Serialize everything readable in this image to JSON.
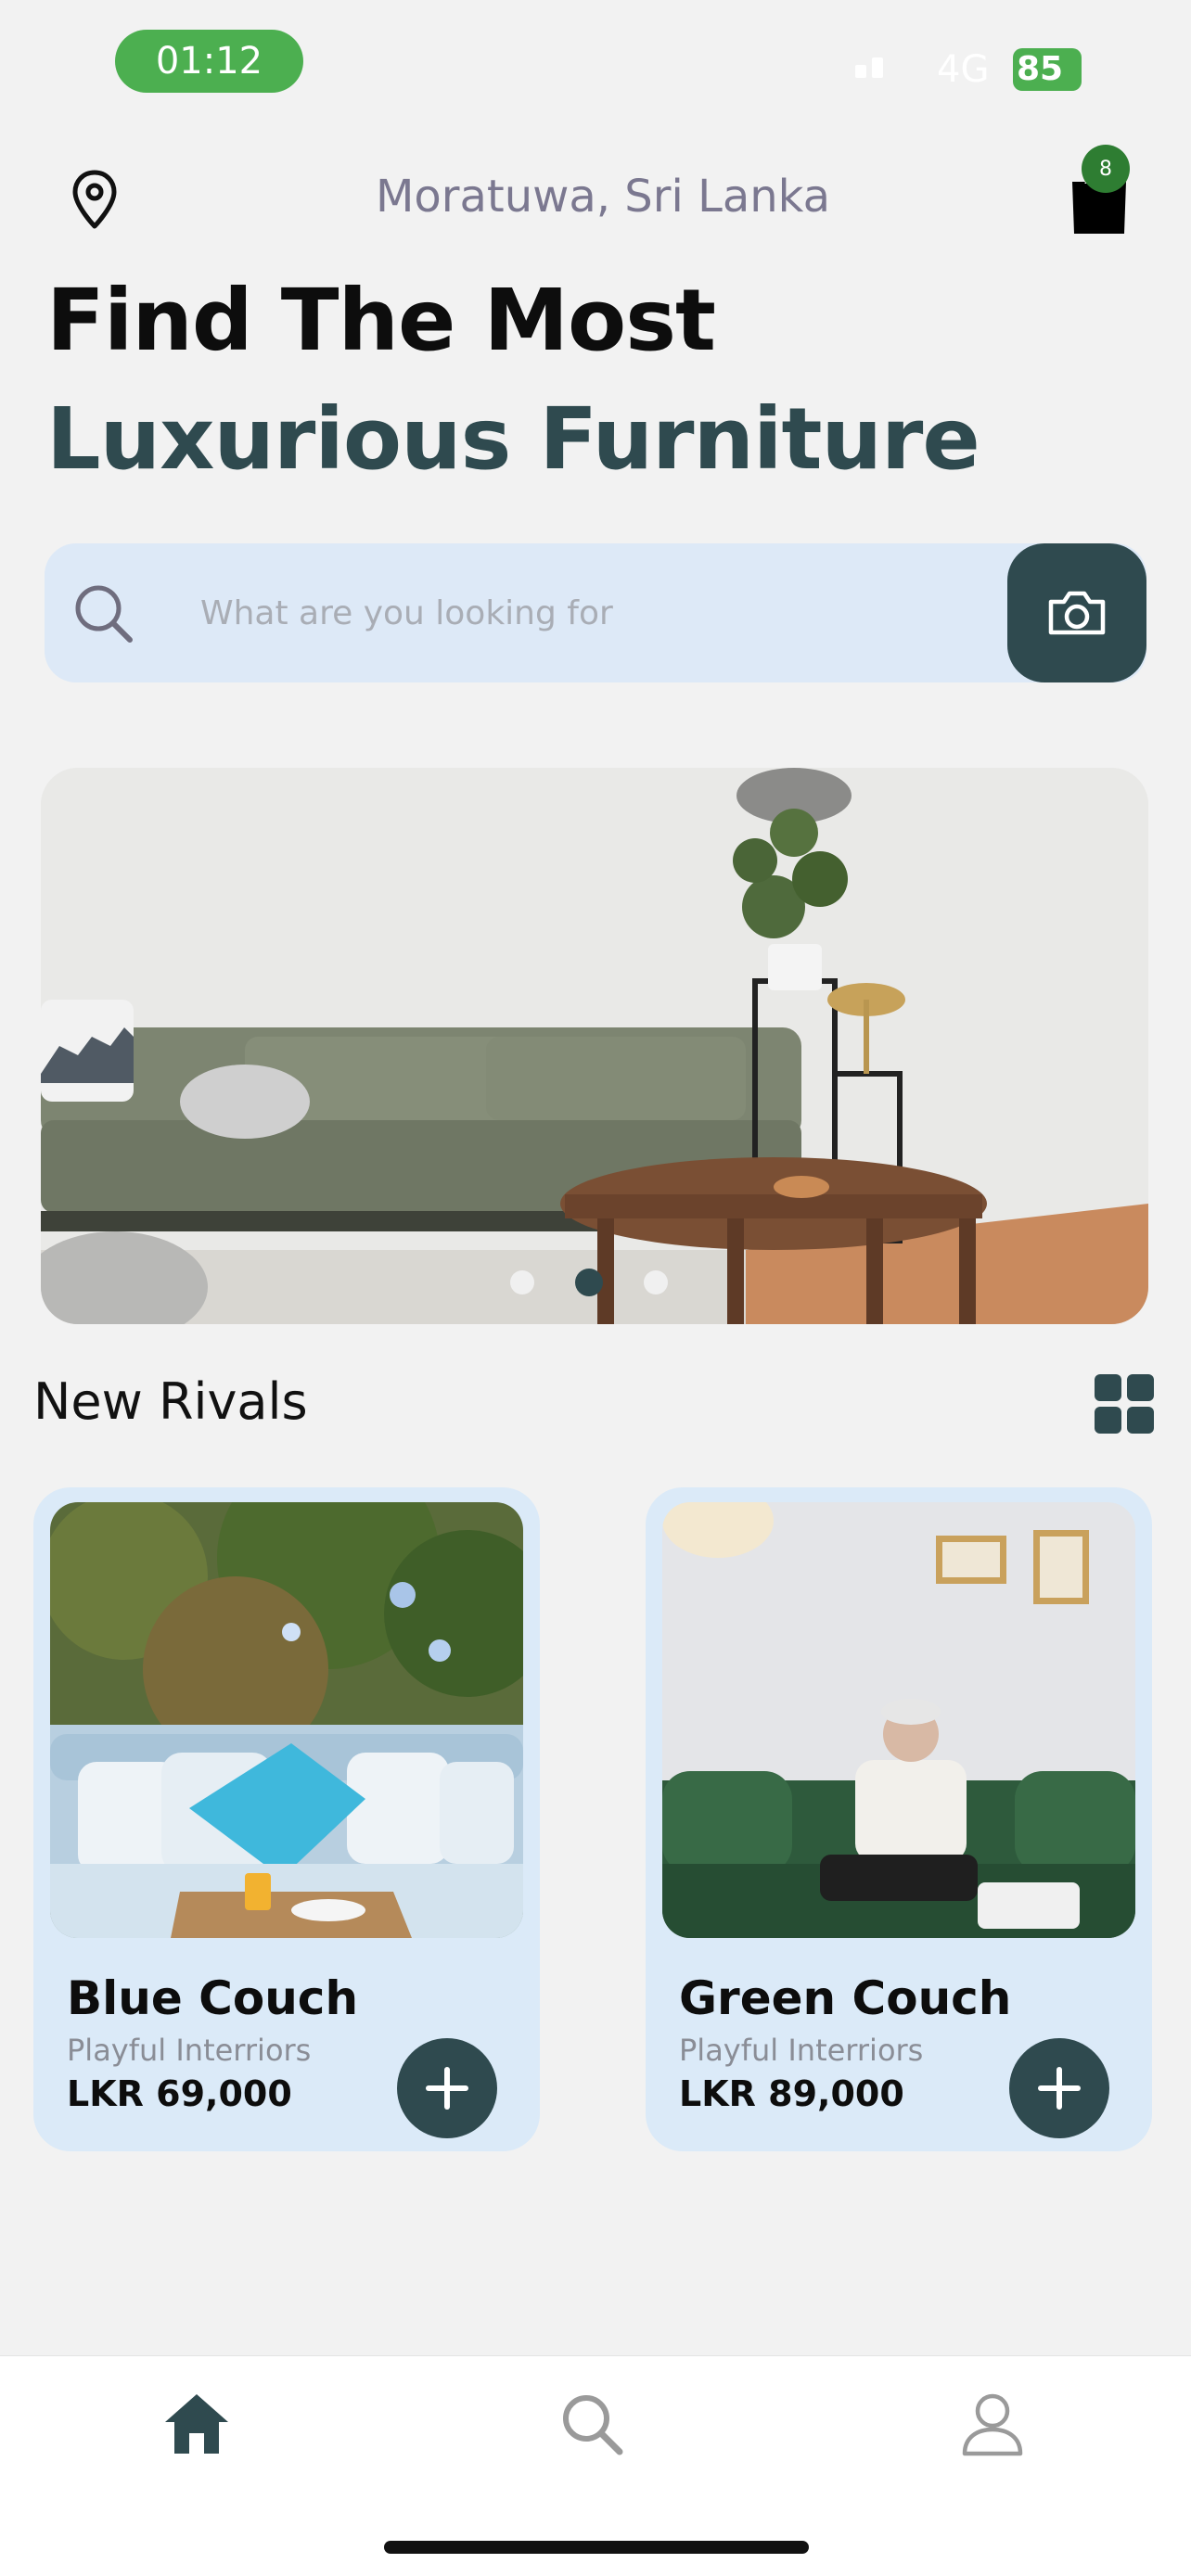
{
  "status_bar": {
    "time": "01:12",
    "network": "4G",
    "battery": "85"
  },
  "header": {
    "location": "Moratuwa, Sri Lanka",
    "cart_count": "8"
  },
  "headline": {
    "line1": "Find The Most",
    "line2": "Luxurious Furniture"
  },
  "search": {
    "placeholder": "What are you looking for"
  },
  "carousel": {
    "slide_count": 3,
    "active_index": 1
  },
  "section": {
    "title": "New Rivals"
  },
  "products": [
    {
      "name": "Blue Couch",
      "seller": "Playful Interriors",
      "price": "LKR 69,000"
    },
    {
      "name": "Green Couch",
      "seller": "Playful Interriors",
      "price": "LKR 89,000"
    }
  ],
  "bottom_nav": {
    "items": [
      {
        "icon": "home-icon",
        "active": true
      },
      {
        "icon": "search-icon",
        "active": false
      },
      {
        "icon": "profile-icon",
        "active": false
      }
    ]
  },
  "colors": {
    "accent": "#2f4a4f",
    "search_bg": "#dde9f7",
    "card_bg": "#dbeaf8",
    "status_green": "#4caf50",
    "badge_green": "#2e7d32"
  }
}
